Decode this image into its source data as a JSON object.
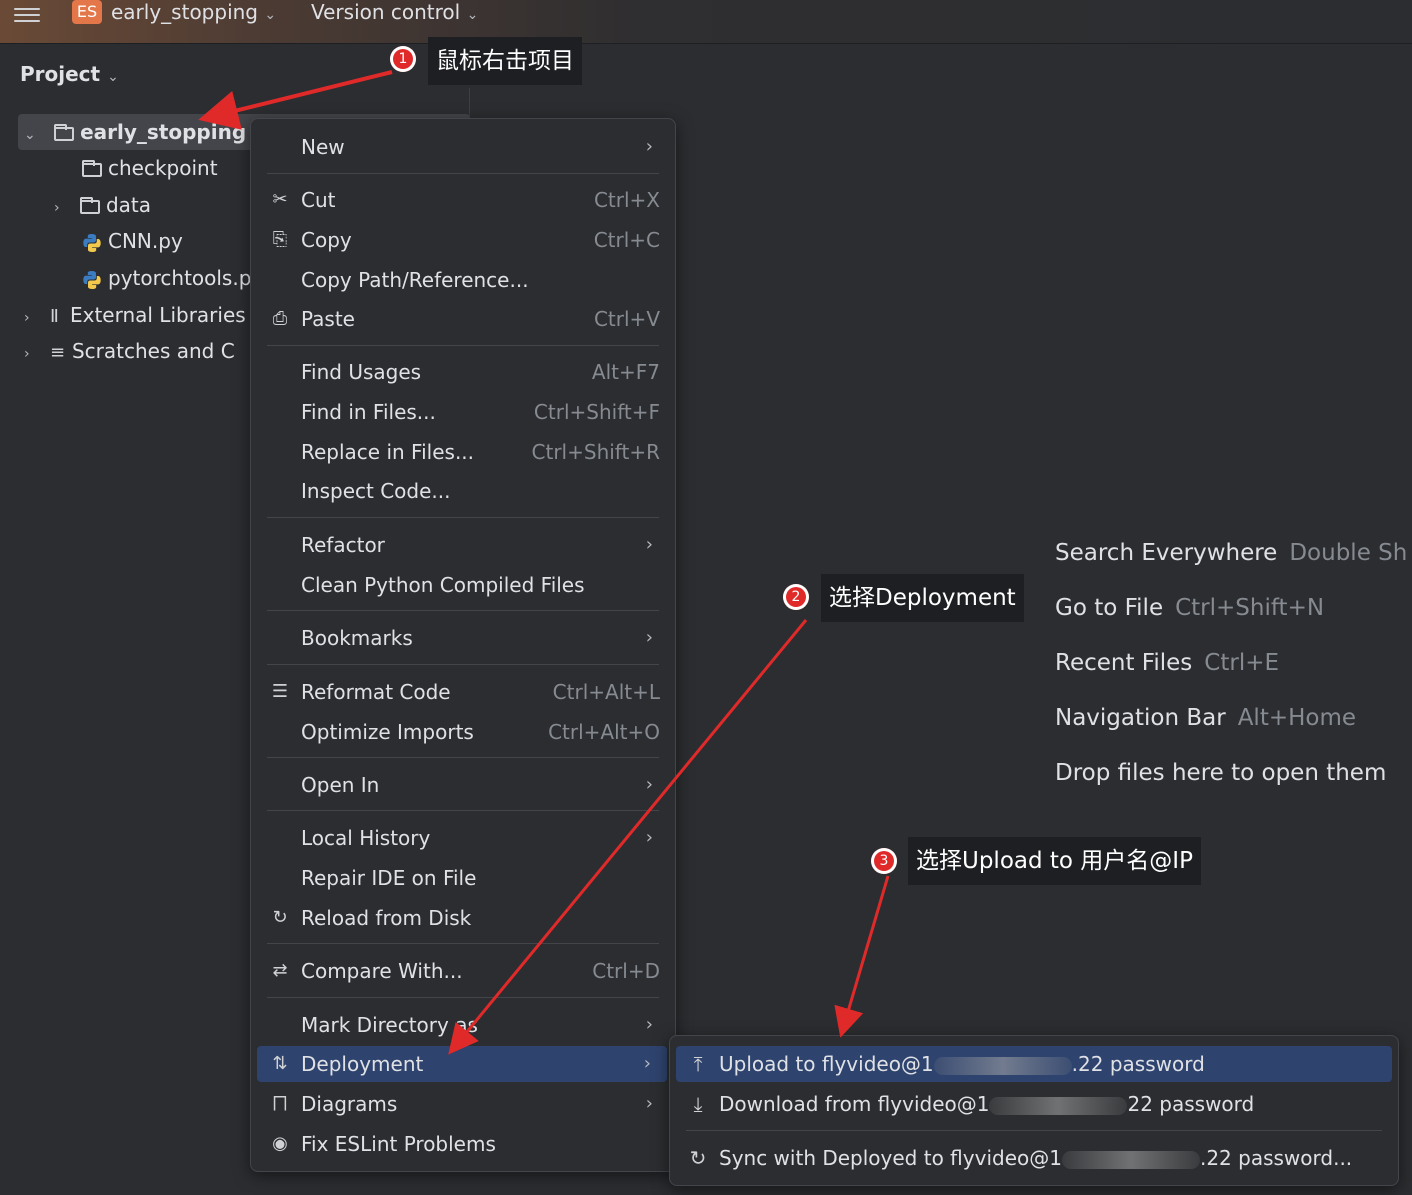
{
  "topbar": {
    "project_badge": "ES",
    "project_name": "early_stopping",
    "vcs": "Version control"
  },
  "project_panel": {
    "title": "Project",
    "tree": {
      "root": "early_stopping",
      "checkpoint": "checkpoint",
      "data": "data",
      "cnn": "CNN.py",
      "pytorchtools": "pytorchtools.p",
      "external": "External Libraries",
      "scratches": "Scratches and C"
    }
  },
  "context_menu": {
    "new": "New",
    "cut": "Cut",
    "cut_sc": "Ctrl+X",
    "copy": "Copy",
    "copy_sc": "Ctrl+C",
    "copy_path": "Copy Path/Reference...",
    "paste": "Paste",
    "paste_sc": "Ctrl+V",
    "find_usages": "Find Usages",
    "find_usages_sc": "Alt+F7",
    "find_files": "Find in Files...",
    "find_files_sc": "Ctrl+Shift+F",
    "replace_files": "Replace in Files...",
    "replace_files_sc": "Ctrl+Shift+R",
    "inspect": "Inspect Code...",
    "refactor": "Refactor",
    "clean": "Clean Python Compiled Files",
    "bookmarks": "Bookmarks",
    "reformat": "Reformat Code",
    "reformat_sc": "Ctrl+Alt+L",
    "optimize": "Optimize Imports",
    "optimize_sc": "Ctrl+Alt+O",
    "open_in": "Open In",
    "local_history": "Local History",
    "repair": "Repair IDE on File",
    "reload": "Reload from Disk",
    "compare": "Compare With...",
    "compare_sc": "Ctrl+D",
    "mark_dir": "Mark Directory as",
    "deployment": "Deployment",
    "diagrams": "Diagrams",
    "eslint": "Fix ESLint Problems"
  },
  "deployment_submenu": {
    "upload_a": "Upload to flyvideo@1",
    "upload_b": ".22 password",
    "download_a": "Download from flyvideo@1",
    "download_b": "22 password",
    "sync_a": "Sync with Deployed to flyvideo@1",
    "sync_b": ".22 password..."
  },
  "editor_hints": {
    "search": "Search Everywhere",
    "search_sc": "Double Sh",
    "goto": "Go to File",
    "goto_sc": "Ctrl+Shift+N",
    "recent": "Recent Files",
    "recent_sc": "Ctrl+E",
    "navbar": "Navigation Bar",
    "navbar_sc": "Alt+Home",
    "drop": "Drop files here to open them"
  },
  "annotations": {
    "step1_num": "1",
    "step1": "鼠标右击项目",
    "step2_num": "2",
    "step2": "选择Deployment",
    "step3_num": "3",
    "step3": "选择Upload to 用户名@IP"
  },
  "colors": {
    "background": "#2b2d30",
    "selection": "#2e436e",
    "annotation_red": "#e02a2a",
    "project_badge": "#e4774a"
  }
}
